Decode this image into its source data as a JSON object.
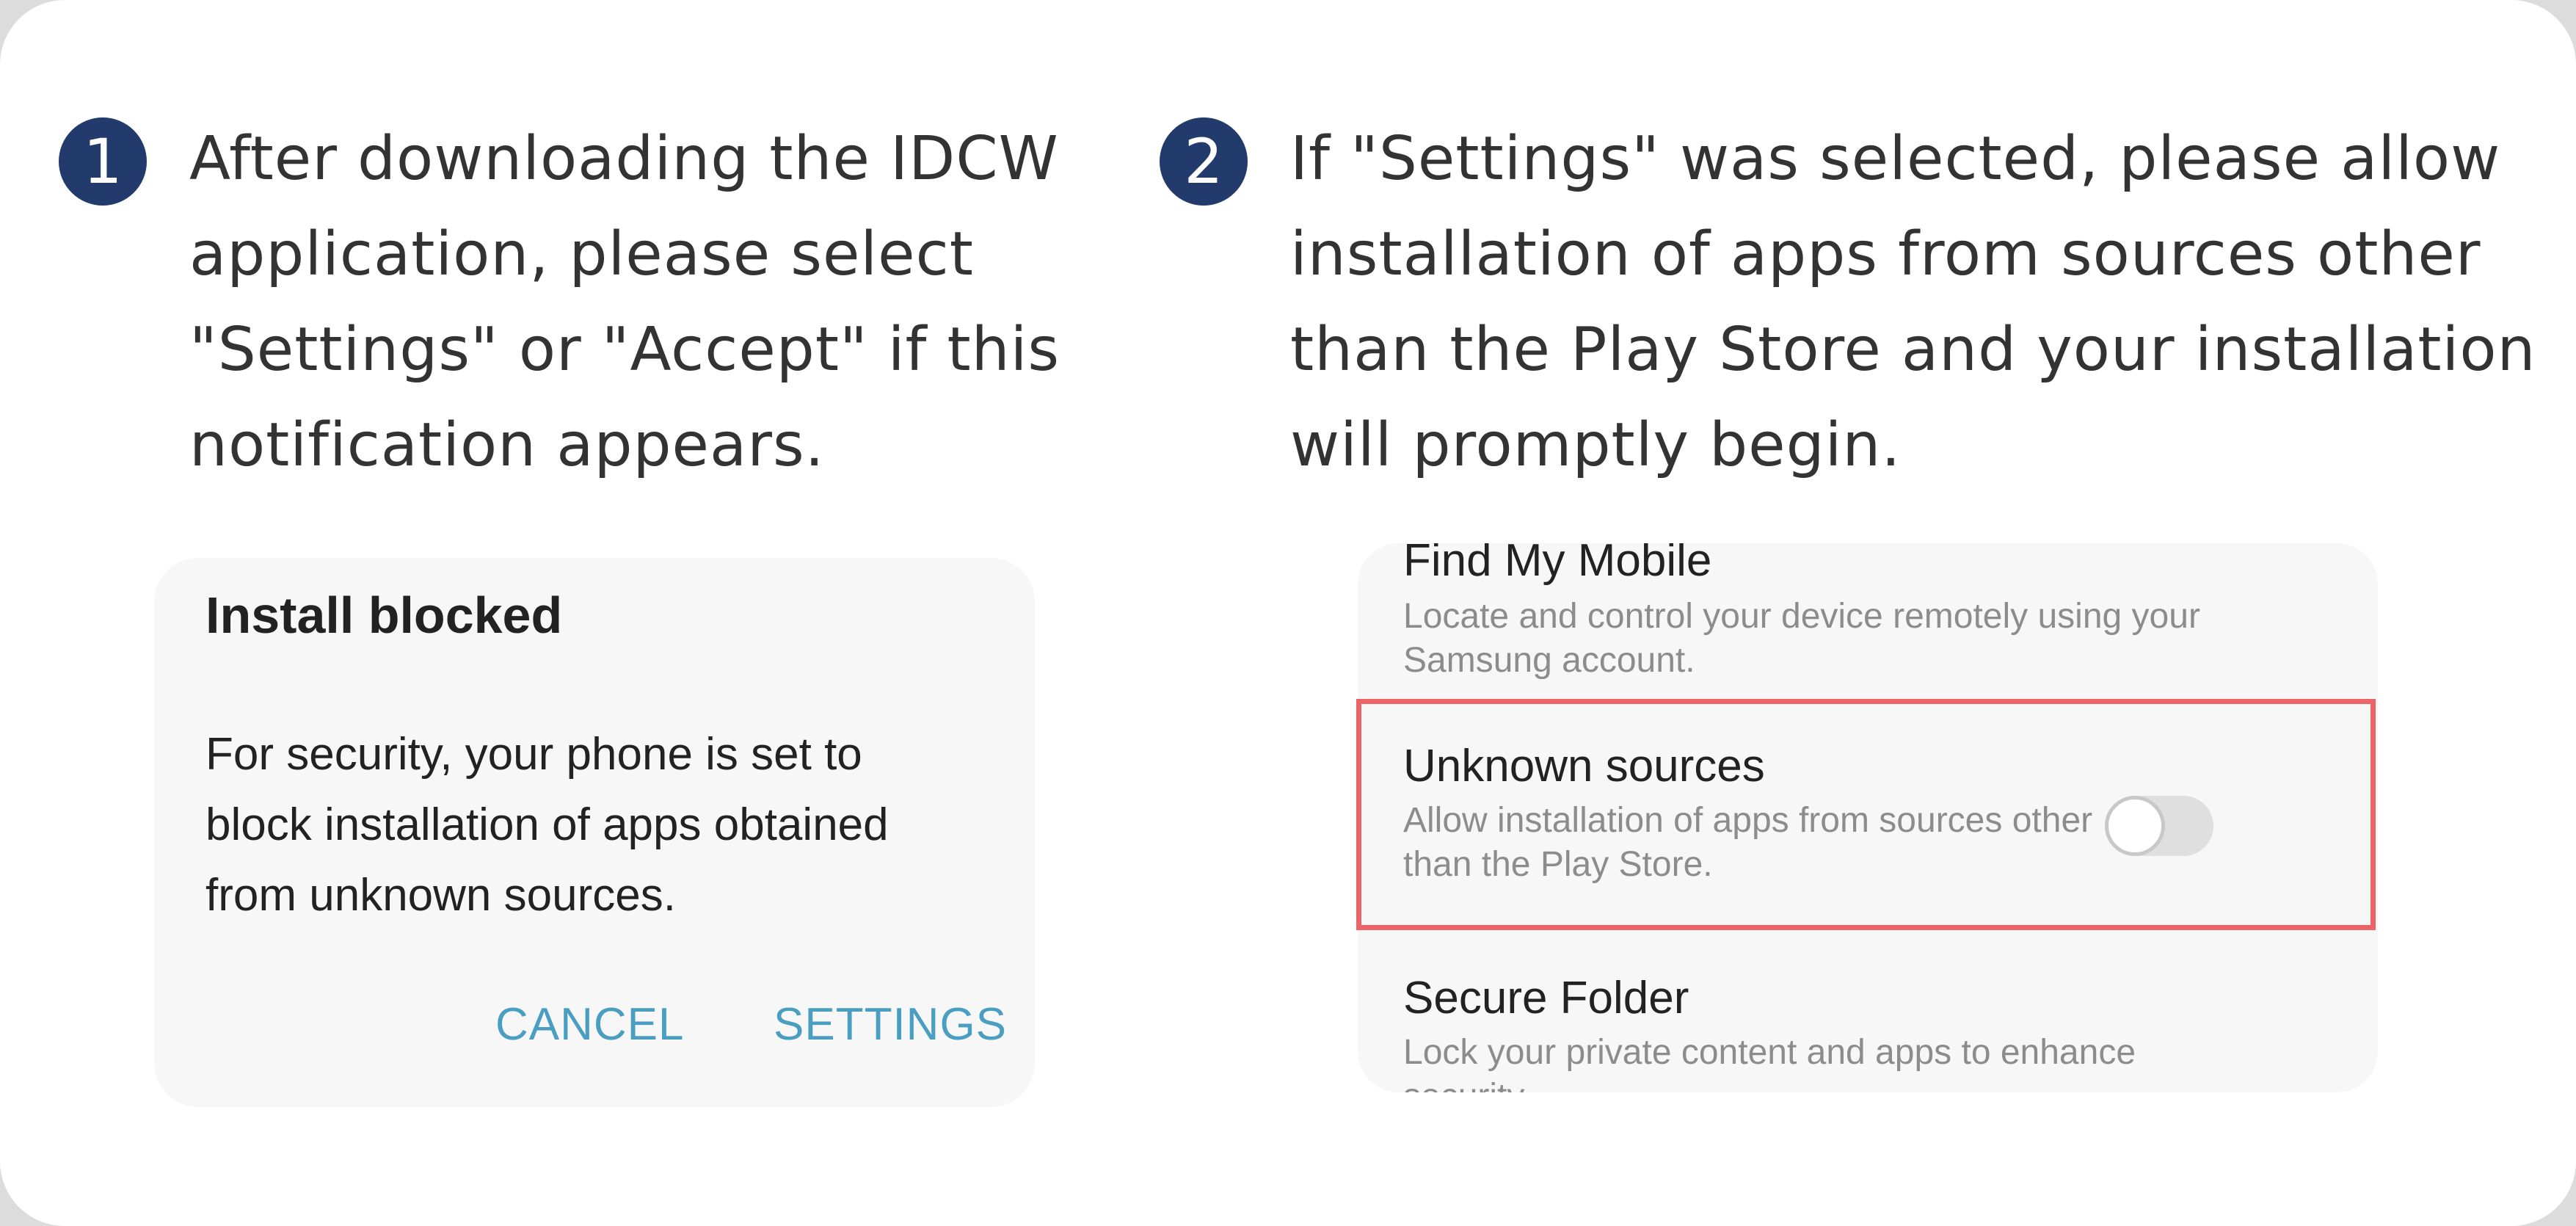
{
  "steps": [
    {
      "number": "1",
      "lines": [
        "After downloading the IDCW",
        "application, please select",
        "\"Settings\" or \"Accept\" if this",
        "notification appears."
      ]
    },
    {
      "number": "2",
      "lines": [
        "If \"Settings\" was selected, please allow",
        "installation of apps from sources other",
        "than the Play Store and your installation",
        "will promptly begin."
      ]
    }
  ],
  "dialog": {
    "title": "Install blocked",
    "message_lines": [
      "For security, your phone is set to",
      "block installation of apps obtained",
      "from unknown sources."
    ],
    "cancel_label": "CANCEL",
    "settings_label": "SETTINGS"
  },
  "settings": {
    "items": [
      {
        "title": "Find My Mobile",
        "description_lines": [
          "Locate and control your device remotely using your",
          "Samsung account."
        ]
      },
      {
        "title": "Unknown sources",
        "description_lines": [
          "Allow installation of apps from sources other",
          "than the Play Store."
        ],
        "toggle_on": false
      },
      {
        "title": "Secure Folder",
        "description_lines": [
          "Lock your private content and apps to enhance",
          "security."
        ]
      }
    ]
  },
  "colors": {
    "step_badge": "#233a6c",
    "button_text": "#4a9ec1",
    "highlight": "#ec6368"
  }
}
